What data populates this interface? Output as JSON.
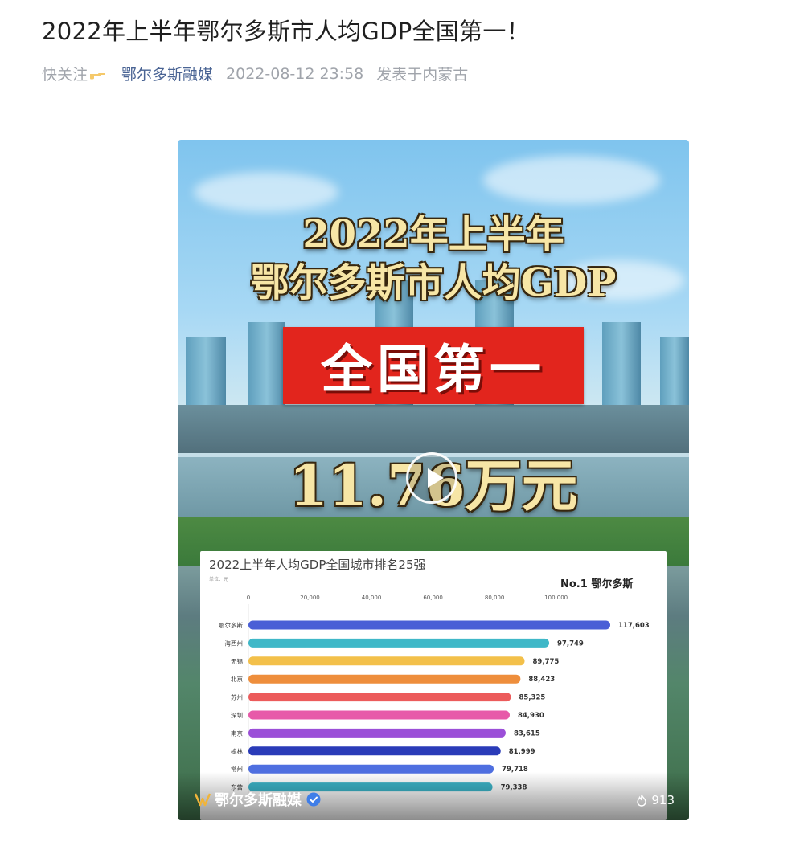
{
  "article": {
    "title": "2022年上半年鄂尔多斯市人均GDP全国第一！",
    "follow_label": "快关注",
    "author": "鄂尔多斯融媒",
    "timestamp": "2022-08-12 23:58",
    "location": "发表于内蒙古"
  },
  "video": {
    "headline_line1": "2022年上半年",
    "headline_line2": "鄂尔多斯市人均GDP",
    "banner_text": "全国第一",
    "big_number": "11.76万元",
    "channel_name": "鄂尔多斯融媒",
    "view_count": "913"
  },
  "chart_data": {
    "type": "bar",
    "orientation": "horizontal",
    "title": "2022上半年人均GDP全国城市排名25强",
    "unit_label": "单位：元",
    "annotation": "No.1 鄂尔多斯",
    "xlim": [
      0,
      117603
    ],
    "x_ticks": [
      0,
      20000,
      40000,
      60000,
      80000,
      100000
    ],
    "x_tick_labels": [
      "0",
      "20,000",
      "40,000",
      "60,000",
      "80,000",
      "100,000"
    ],
    "grid": false,
    "categories": [
      "鄂尔多斯",
      "海西州",
      "无锡",
      "北京",
      "苏州",
      "深圳",
      "南京",
      "榆林",
      "常州",
      "东营"
    ],
    "values": [
      117603,
      97749,
      89775,
      88423,
      85325,
      84930,
      83615,
      81999,
      79718,
      79338
    ],
    "value_labels": [
      "117,603",
      "97,749",
      "89,775",
      "88,423",
      "85,325",
      "84,930",
      "83,615",
      "81,999",
      "79,718",
      "79,338"
    ],
    "colors": [
      "#4a5fd6",
      "#3fb8c8",
      "#f3c04a",
      "#ee8e3c",
      "#ec5b5b",
      "#e75aa9",
      "#9b4fd8",
      "#2a3bb8",
      "#4f6fe0",
      "#3cb4c8"
    ]
  }
}
